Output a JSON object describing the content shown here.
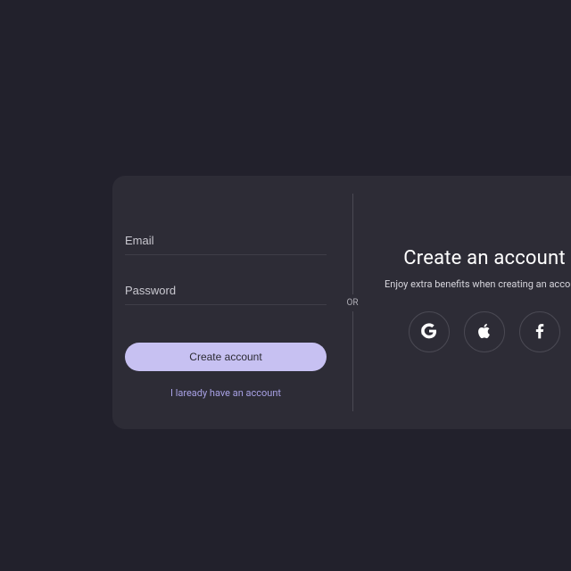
{
  "form": {
    "email_placeholder": "Email",
    "password_placeholder": "Password",
    "create_button": "Create account",
    "have_account": "I laready have an account"
  },
  "divider": {
    "label": "OR"
  },
  "right": {
    "title": "Create an account",
    "subtitle": "Enjoy extra benefits when creating an account"
  },
  "socials": {
    "google": "google-icon",
    "apple": "apple-icon",
    "facebook": "facebook-icon"
  },
  "colors": {
    "accent": "#c7c1f2",
    "card_bg": "#2d2c36",
    "page_bg": "#22212c"
  }
}
